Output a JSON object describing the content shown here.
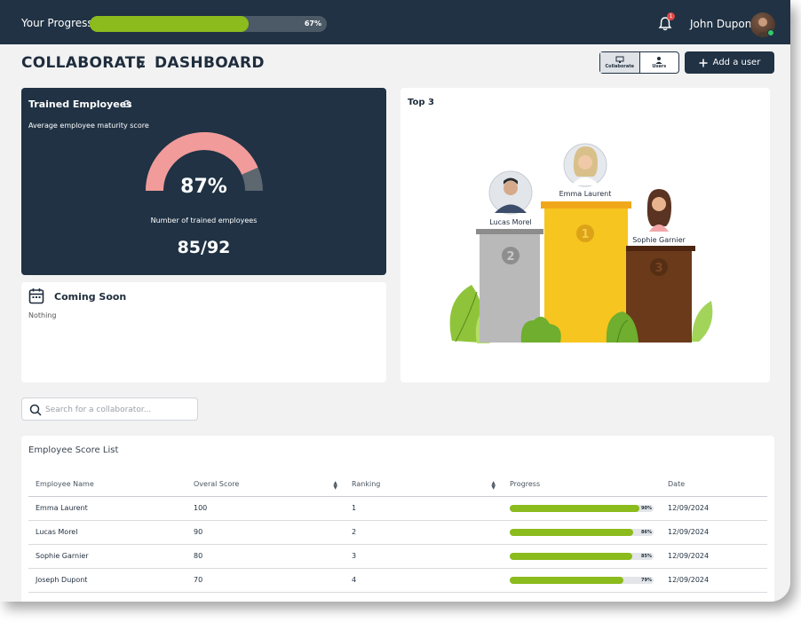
{
  "topbar": {
    "progress_label": "Your Progress:",
    "progress_value": 0.67,
    "progress_text": "67%",
    "notification_count": "1",
    "user_name": "John Dupont"
  },
  "header": {
    "crumb_root": "COLLABORATE",
    "crumb_current": "DASHBOARD",
    "tab_collaborate": "Collaborate",
    "tab_users": "Users",
    "add_user_label": "Add a user"
  },
  "trained": {
    "title": "Trained Employees",
    "help": "?",
    "subtitle": "Average employee maturity score",
    "percent_text": "87%",
    "percent_value": 0.87,
    "count_label": "Number of trained employees",
    "count": "85/92"
  },
  "coming_soon": {
    "title": "Coming Soon",
    "text": "Nothing"
  },
  "top3": {
    "title": "Top 3",
    "first": {
      "name": "Emma Laurent",
      "rank": "1"
    },
    "second": {
      "name": "Lucas Morel",
      "rank": "2"
    },
    "third": {
      "name": "Sophie Garnier",
      "rank": "3"
    }
  },
  "search": {
    "placeholder": "Search for a collaborator..."
  },
  "list": {
    "title": "Employee Score List",
    "columns": [
      "Employee Name",
      "Overal Score",
      "Ranking",
      "Progress",
      "Date"
    ],
    "rows": [
      {
        "name": "Emma Laurent",
        "score": "100",
        "rank": "1",
        "progress": 0.9,
        "progress_text": "90%",
        "date": "12/09/2024"
      },
      {
        "name": "Lucas Morel",
        "score": "90",
        "rank": "2",
        "progress": 0.86,
        "progress_text": "86%",
        "date": "12/09/2024"
      },
      {
        "name": "Sophie Garnier",
        "score": "80",
        "rank": "3",
        "progress": 0.85,
        "progress_text": "85%",
        "date": "12/09/2024"
      },
      {
        "name": "Joseph Dupont",
        "score": "70",
        "rank": "4",
        "progress": 0.79,
        "progress_text": "79%",
        "date": "12/09/2024"
      }
    ]
  },
  "colors": {
    "navy": "#203244",
    "green": "#8bbb1c",
    "gold": "#f5c01e",
    "silver": "#b5b5b5",
    "bronze": "#6b3a1a",
    "gauge_pink": "#f29b9b"
  }
}
